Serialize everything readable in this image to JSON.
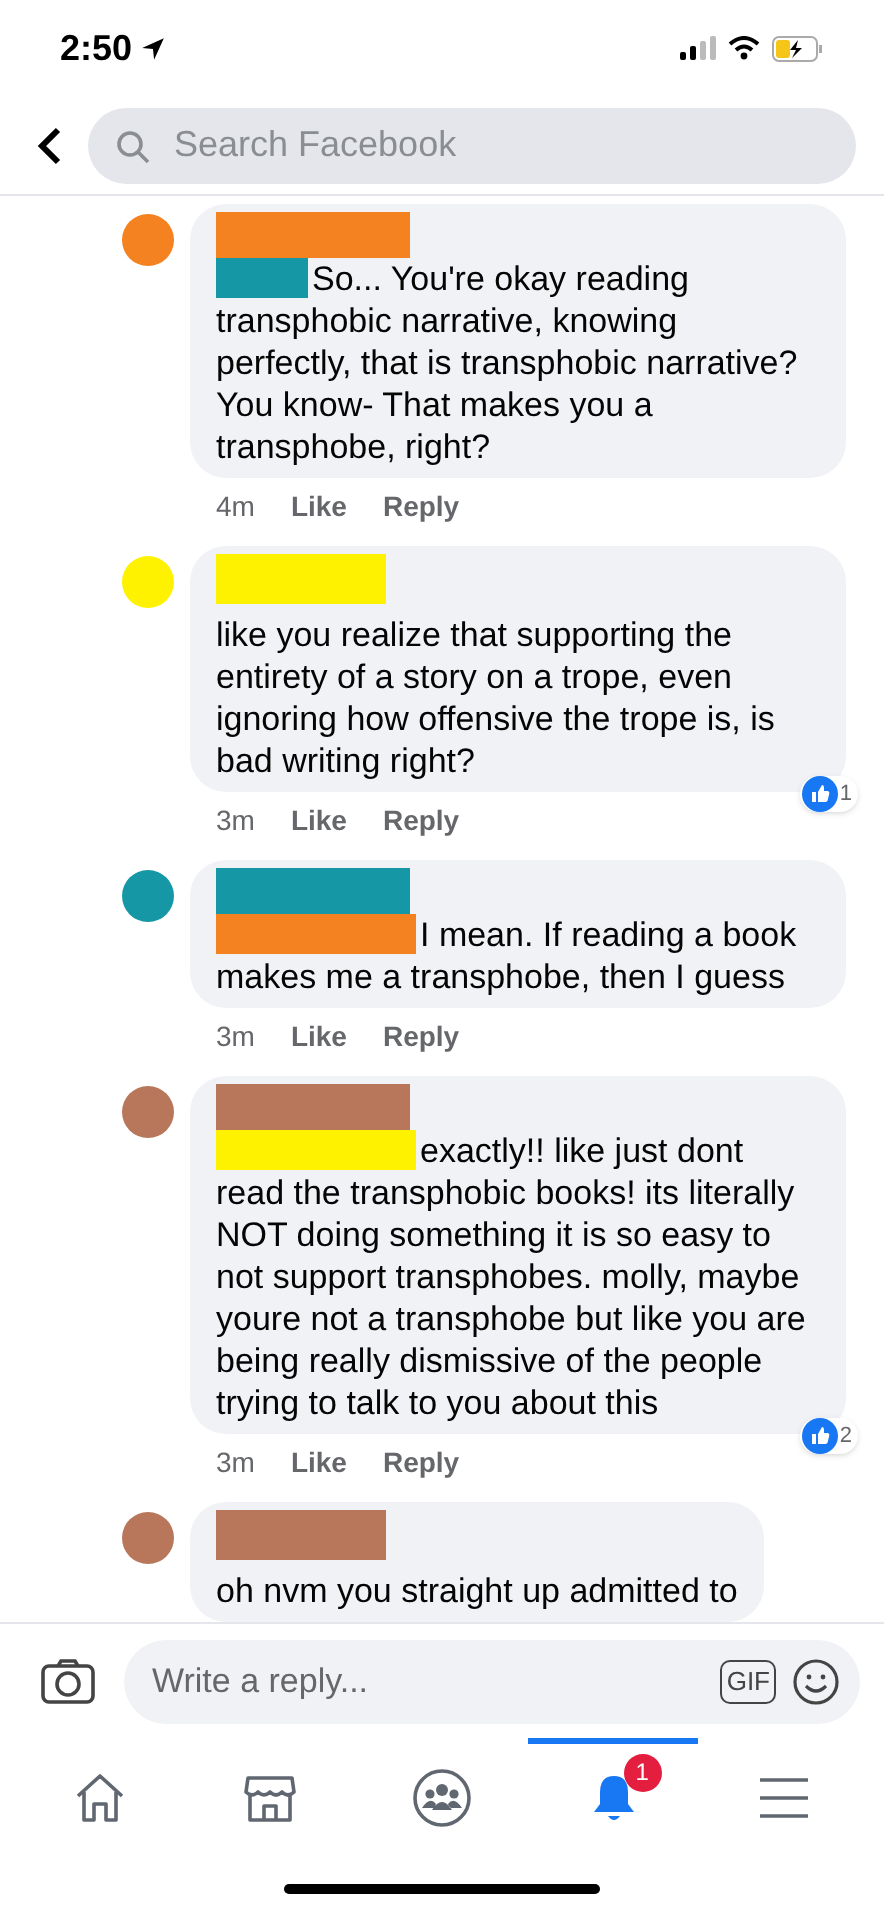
{
  "status_bar": {
    "time": "2:50"
  },
  "search": {
    "placeholder": "Search Facebook"
  },
  "comments": [
    {
      "avatar": {
        "color": "#f58220"
      },
      "name_redaction": {
        "color": "#f58220"
      },
      "inline_redaction": {
        "color": "#1597a5"
      },
      "text": "So... You're okay reading transphobic narrative, knowing perfectly, that is transphobic narrative? You know- That makes you a transphobe, right?",
      "time": "4m",
      "like": "Like",
      "reply": "Reply"
    },
    {
      "avatar": {
        "color": "#fff200"
      },
      "name_redaction": {
        "color": "#fff200"
      },
      "text": "like you realize that supporting the entirety of a story on a trope, even ignoring how offensive the trope is, is bad writing right?",
      "time": "3m",
      "like": "Like",
      "reply": "Reply",
      "reactions": "1"
    },
    {
      "avatar": {
        "color": "#1597a5"
      },
      "name_redaction": {
        "color": "#1597a5"
      },
      "inline_redaction": {
        "color": "#f58220"
      },
      "text": "I mean. If reading a book makes me a transphobe, then I guess",
      "time": "3m",
      "like": "Like",
      "reply": "Reply"
    },
    {
      "avatar": {
        "color": "#b8775a"
      },
      "name_redaction": {
        "color": "#b8775a"
      },
      "inline_redaction": {
        "color": "#fff200"
      },
      "text": "exactly!! like just dont read the transphobic books! its literally NOT doing something it is so easy to not support transphobes. molly, maybe youre not a transphobe but like you are being really dismissive of the people trying to talk to you about this",
      "time": "3m",
      "like": "Like",
      "reply": "Reply",
      "reactions": "2"
    },
    {
      "avatar": {
        "color": "#b8775a"
      },
      "name_redaction": {
        "color": "#b8775a"
      },
      "text": "oh nvm you straight up admitted to"
    }
  ],
  "reply_bar": {
    "placeholder": "Write a reply...",
    "gif": "GIF"
  },
  "nav": [
    {
      "kind": "home",
      "selected": false
    },
    {
      "kind": "marketplace",
      "selected": false
    },
    {
      "kind": "groups",
      "selected": false
    },
    {
      "kind": "notifications",
      "selected": true,
      "badge": "1"
    },
    {
      "kind": "menu",
      "selected": false
    }
  ]
}
